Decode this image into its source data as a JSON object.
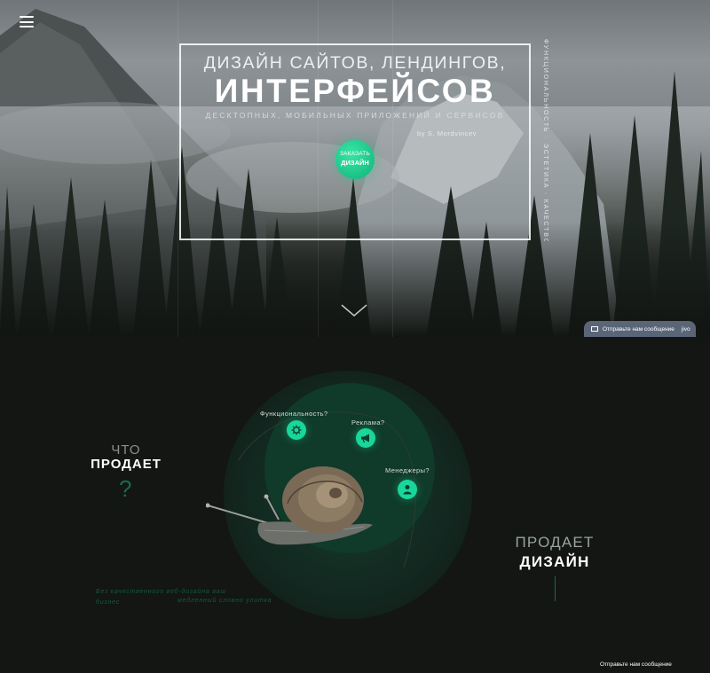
{
  "hero": {
    "title_line1": "ДИЗАЙН САЙТОВ, ЛЕНДИНГОВ,",
    "title_line2": "ИНТЕРФЕЙСОВ",
    "subtitle": "ДЕСКТОПНЫХ, МОБИЛЬНЫХ ПРИЛОЖЕНИЙ И СЕРВИСОВ",
    "byline": "by S. Mordvincev",
    "cta_line1": "ЗАКАЗАТЬ",
    "cta_line2": "ДИЗАЙН",
    "vertical_text": "ФУНКЦИОНАЛЬНОСТЬ · ЭСТЕТИКА · КАЧЕСТВО"
  },
  "chat": {
    "tab_label": "Отправьте нам сообщение",
    "brand": "jivo",
    "bottom_label": "Отправьте нам сообщение"
  },
  "section2": {
    "left_heading_top": "ЧТО",
    "left_heading_bottom": "ПРОДАЕТ",
    "left_mark": "?",
    "nodes": [
      {
        "label": "Функциональность?",
        "icon": "gear-icon"
      },
      {
        "label": "Реклама?",
        "icon": "megaphone-icon"
      },
      {
        "label": "Менеджеры?",
        "icon": "person-icon"
      }
    ],
    "right_heading_top": "ПРОДАЕТ",
    "right_heading_bottom": "ДИЗАЙН",
    "caption_line1": "Без качественного веб-дизайна ваш бизнес",
    "caption_line2": "медленный словно улитка"
  },
  "colors": {
    "accent": "#19d69a",
    "dark_bg": "#131613",
    "circle_bg": "#103a2a",
    "chat_tab": "#5a6678"
  }
}
